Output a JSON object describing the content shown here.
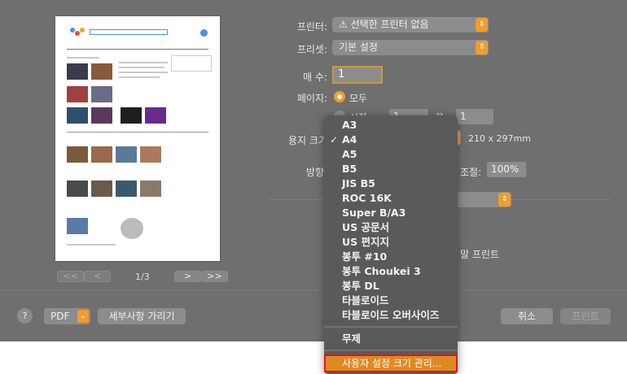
{
  "printer": {
    "label": "프린터:",
    "value": "선택한 프린터 없음"
  },
  "preset": {
    "label": "프리셋:",
    "value": "기본 설정"
  },
  "copies": {
    "label": "매 수:",
    "value": "1"
  },
  "pages": {
    "label": "페이지:",
    "all_label": "모두",
    "from_label": "시작:",
    "from_value": "1",
    "to_label": "끝:",
    "to_value": "1"
  },
  "paper_size": {
    "label": "용지 크기",
    "dimensions": "210 x 297mm"
  },
  "orientation": {
    "label": "방향"
  },
  "scale": {
    "label": "조절:",
    "value": "100%"
  },
  "partial_print_text": "말 프린트",
  "preview": {
    "page_counter": "1/3",
    "prev_first": "<<",
    "prev": "<",
    "next": ">",
    "next_last": ">>"
  },
  "bottom": {
    "help": "?",
    "pdf": "PDF",
    "hide_details": "세부사항 가리기",
    "cancel": "취소",
    "print": "프린트"
  },
  "paper_menu": {
    "items": [
      "A3",
      "A4",
      "A5",
      "B5",
      "JIS B5",
      "ROC 16K",
      "Super B/A3",
      "US 공문서",
      "US 편지지",
      "봉투 #10",
      "봉투 Choukei 3",
      "봉투 DL",
      "타블로이드",
      "타블로이드 오버사이즈"
    ],
    "selected": "A4",
    "borderless": "무제",
    "manage_custom": "사용자 설정 크기 관리..."
  },
  "colors": {
    "accent": "#f29c2c",
    "dialog_bg": "#6f6f6f",
    "highlight_border": "#e0161a"
  }
}
